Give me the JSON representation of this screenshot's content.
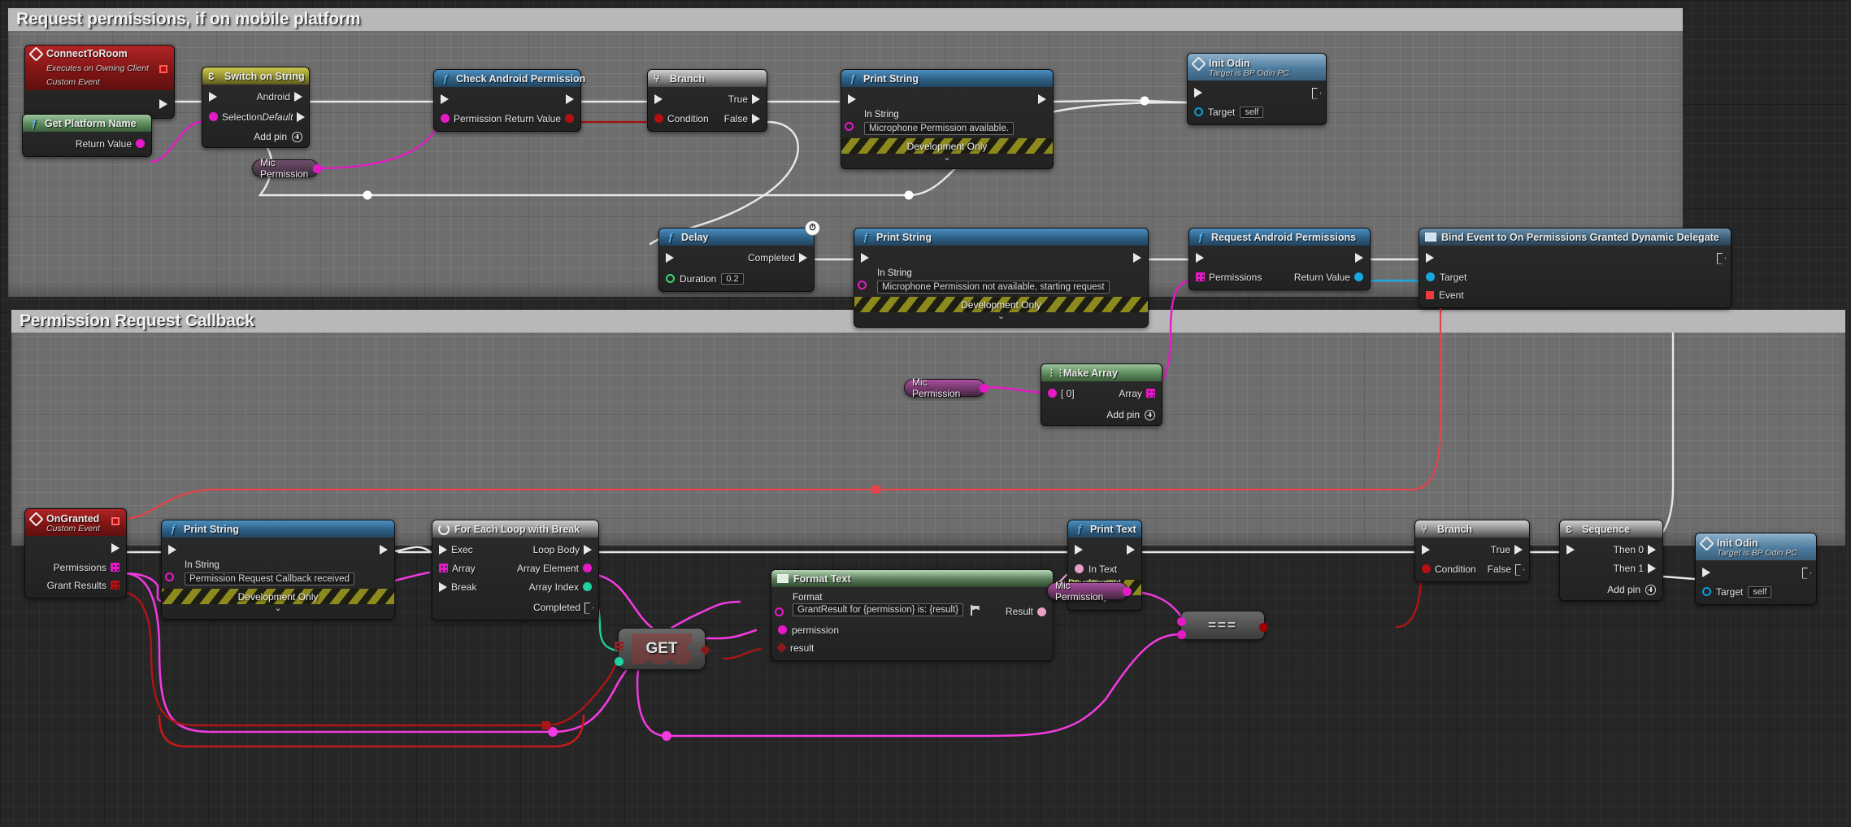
{
  "comments": [
    {
      "id": "c1",
      "title": "Request permissions, if on mobile platform"
    },
    {
      "id": "c2",
      "title": "Permission Request Callback"
    }
  ],
  "colors": {
    "exec": "#e8e8e8",
    "string": "#e619c6",
    "bool": "#9c0000",
    "object": "#0a9ddb",
    "float": "#39d66a",
    "integer": "#1fd3a0",
    "text": "#e8a0c8",
    "delegate": "#e03232",
    "comment_bar": "#b8b8b8",
    "comment_body": "#6e6e6e"
  },
  "nodes": {
    "connect_to_room": {
      "title": "ConnectToRoom",
      "sub1": "Executes on Owning Client",
      "sub2": "Custom Event"
    },
    "get_platform_name": {
      "title": "Get Platform Name",
      "out": "Return Value"
    },
    "switch_on_string": {
      "title": "Switch on String",
      "in_selection": "Selection",
      "out_android": "Android",
      "out_default": "Default",
      "add_pin": "Add pin"
    },
    "mic_permission_1": {
      "label": "Mic Permission"
    },
    "mic_permission_2": {
      "label": "Mic Permission"
    },
    "mic_permission_3": {
      "label": "Mic Permission"
    },
    "check_android_permission": {
      "title": "Check Android Permission",
      "in_permission": "Permission",
      "out_return": "Return Value"
    },
    "branch_1": {
      "title": "Branch",
      "in_condition": "Condition",
      "out_true": "True",
      "out_false": "False"
    },
    "print_string_1": {
      "title": "Print String",
      "in_label": "In String",
      "in_value": "Microphone Permission available.",
      "dev_only": "Development Only"
    },
    "init_odin_1": {
      "title": "Init Odin",
      "sub": "Target is BP Odin PC",
      "target_label": "Target",
      "target_value": "self"
    },
    "delay": {
      "title": "Delay",
      "out_completed": "Completed",
      "in_duration": "Duration",
      "duration_value": "0.2"
    },
    "print_string_2": {
      "title": "Print String",
      "in_label": "In String",
      "in_value": "Microphone Permission not available, starting request",
      "dev_only": "Development Only"
    },
    "request_android_permissions": {
      "title": "Request Android Permissions",
      "in_permissions": "Permissions",
      "out_return": "Return Value"
    },
    "bind_event": {
      "title": "Bind Event to On Permissions Granted Dynamic Delegate",
      "in_target": "Target",
      "in_event": "Event"
    },
    "make_array": {
      "title": "Make Array",
      "in_0": "[ 0]",
      "out_array": "Array",
      "add_pin": "Add pin"
    },
    "on_granted": {
      "title": "OnGranted",
      "sub": "Custom Event",
      "out_permissions": "Permissions",
      "out_grant_results": "Grant Results"
    },
    "print_string_3": {
      "title": "Print String",
      "in_label": "In String",
      "in_value": "Permission Request Callback received",
      "dev_only": "Development Only"
    },
    "for_each_loop": {
      "title": "For Each Loop with Break",
      "in_exec": "Exec",
      "in_array": "Array",
      "in_break": "Break",
      "out_loop_body": "Loop Body",
      "out_array_element": "Array Element",
      "out_array_index": "Array Index",
      "out_completed": "Completed"
    },
    "get_node": {
      "label": "GET"
    },
    "format_text": {
      "title": "Format Text",
      "format_label": "Format",
      "format_value": "GrantResult for {permission} is: {result}",
      "in_permission": "permission",
      "in_result": "result",
      "out_result": "Result"
    },
    "print_text": {
      "title": "Print Text",
      "in_text": "In Text",
      "dev_only": "Development Only"
    },
    "equals_node": {
      "label": "==="
    },
    "branch_2": {
      "title": "Branch",
      "in_condition": "Condition",
      "out_true": "True",
      "out_false": "False"
    },
    "sequence": {
      "title": "Sequence",
      "out_then0": "Then 0",
      "out_then1": "Then 1",
      "add_pin": "Add pin"
    },
    "init_odin_2": {
      "title": "Init Odin",
      "sub": "Target is BP Odin PC",
      "target_label": "Target",
      "target_value": "self"
    }
  }
}
